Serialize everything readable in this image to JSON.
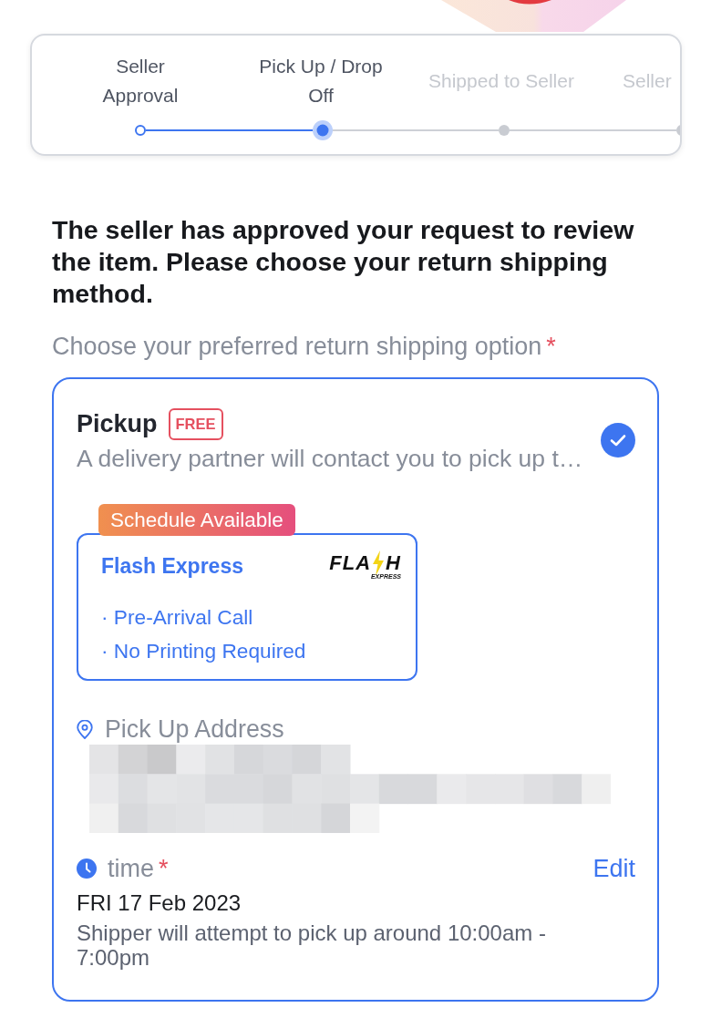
{
  "stepper": {
    "steps": [
      {
        "label": "Seller\nApproval",
        "completed": true,
        "selected": false,
        "cut_off": false
      },
      {
        "label": "Pick Up / Drop\nOff",
        "completed": false,
        "selected": true,
        "cut_off": false
      },
      {
        "label": "Shipped to Seller",
        "completed": false,
        "selected": false,
        "cut_off": false
      },
      {
        "label": "Seller",
        "completed": false,
        "selected": false,
        "cut_off": true
      }
    ]
  },
  "heading": "The seller has approved your request to review the item. Please choose your return shipping method.",
  "prompt": {
    "label": "Choose your preferred return shipping option",
    "required_mark": "*"
  },
  "options": [
    {
      "title": "Pickup",
      "badge": "FREE",
      "description": "A delivery partner will contact you to pick up t…",
      "selected": true,
      "tag": "Schedule Available",
      "courier": {
        "name": "Flash Express",
        "logo": {
          "left": "FLA",
          "right": "H",
          "sub": "EXPRESS"
        },
        "features": [
          "· Pre-Arrival Call",
          "· No Printing Required"
        ]
      },
      "address": {
        "label": "Pick Up Address"
      },
      "time": {
        "label": "time",
        "required_mark": "*",
        "action": "Edit",
        "date": "FRI 17 Feb 2023",
        "note": "Shipper will attempt to pick up around 10:00am - 7:00pm"
      }
    }
  ]
}
